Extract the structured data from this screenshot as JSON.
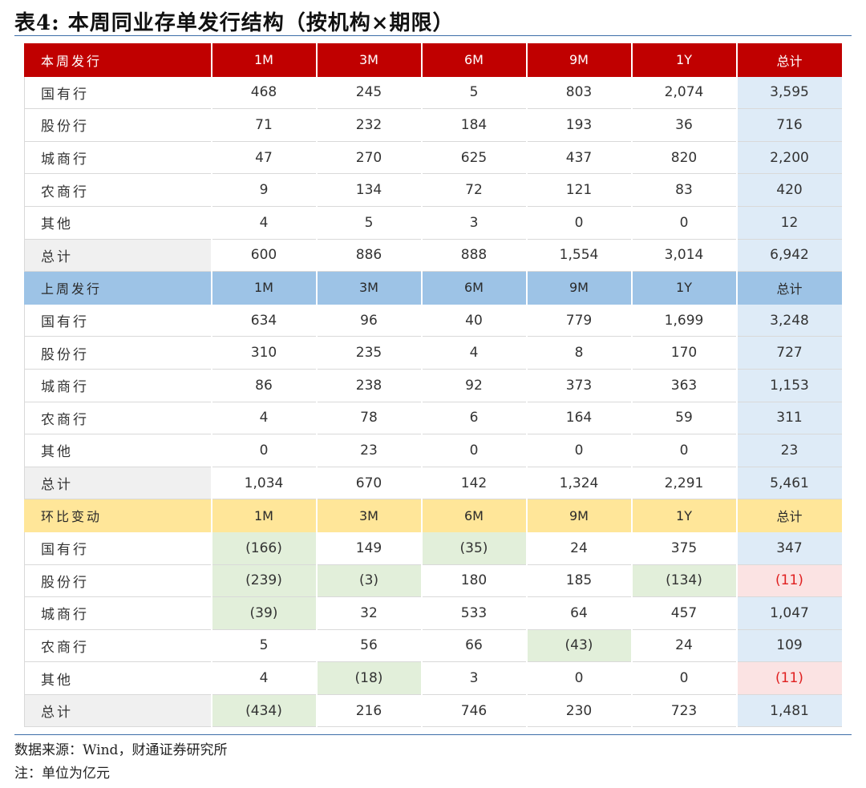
{
  "title": "表4: 本周同业存单发行结构（按机构×期限）",
  "columns": [
    "1M",
    "3M",
    "6M",
    "9M",
    "1Y",
    "总计"
  ],
  "sections": [
    {
      "header": "本周发行",
      "style": "red",
      "rows": [
        {
          "label": "国有行",
          "cells": [
            "468",
            "245",
            "5",
            "803",
            "2,074",
            "3,595"
          ]
        },
        {
          "label": "股份行",
          "cells": [
            "71",
            "232",
            "184",
            "193",
            "36",
            "716"
          ]
        },
        {
          "label": "城商行",
          "cells": [
            "47",
            "270",
            "625",
            "437",
            "820",
            "2,200"
          ]
        },
        {
          "label": "农商行",
          "cells": [
            "9",
            "134",
            "72",
            "121",
            "83",
            "420"
          ]
        },
        {
          "label": "其他",
          "cells": [
            "4",
            "5",
            "3",
            "0",
            "0",
            "12"
          ]
        },
        {
          "label": "总计",
          "cells": [
            "600",
            "886",
            "888",
            "1,554",
            "3,014",
            "6,942"
          ]
        }
      ]
    },
    {
      "header": "上周发行",
      "style": "blue",
      "rows": [
        {
          "label": "国有行",
          "cells": [
            "634",
            "96",
            "40",
            "779",
            "1,699",
            "3,248"
          ]
        },
        {
          "label": "股份行",
          "cells": [
            "310",
            "235",
            "4",
            "8",
            "170",
            "727"
          ]
        },
        {
          "label": "城商行",
          "cells": [
            "86",
            "238",
            "92",
            "373",
            "363",
            "1,153"
          ]
        },
        {
          "label": "农商行",
          "cells": [
            "4",
            "78",
            "6",
            "164",
            "59",
            "311"
          ]
        },
        {
          "label": "其他",
          "cells": [
            "0",
            "23",
            "0",
            "0",
            "0",
            "23"
          ]
        },
        {
          "label": "总计",
          "cells": [
            "1,034",
            "670",
            "142",
            "1,324",
            "2,291",
            "5,461"
          ]
        }
      ]
    },
    {
      "header": "环比变动",
      "style": "yellow",
      "rows": [
        {
          "label": "国有行",
          "cells": [
            "(166)",
            "149",
            "(35)",
            "24",
            "375",
            "347"
          ]
        },
        {
          "label": "股份行",
          "cells": [
            "(239)",
            "(3)",
            "180",
            "185",
            "(134)",
            "(11)"
          ]
        },
        {
          "label": "城商行",
          "cells": [
            "(39)",
            "32",
            "533",
            "64",
            "457",
            "1,047"
          ]
        },
        {
          "label": "农商行",
          "cells": [
            "5",
            "56",
            "66",
            "(43)",
            "24",
            "109"
          ]
        },
        {
          "label": "其他",
          "cells": [
            "4",
            "(18)",
            "3",
            "0",
            "0",
            "(11)"
          ]
        },
        {
          "label": "总计",
          "cells": [
            "(434)",
            "216",
            "746",
            "230",
            "723",
            "1,481"
          ]
        }
      ]
    }
  ],
  "source_note": "数据来源：Wind，财通证券研究所",
  "unit_note": "注：单位为亿元",
  "colors": {
    "header_red": "#c00000",
    "header_blue": "#9dc3e6",
    "header_yellow": "#ffe699",
    "total_fill": "#deebf7",
    "total_text": "#1f5fa8",
    "negative_fill": "#e2efda",
    "negative_total_fill": "#fbe3e3",
    "negative_total_text": "#e02020",
    "rule": "#3d6ea8"
  }
}
